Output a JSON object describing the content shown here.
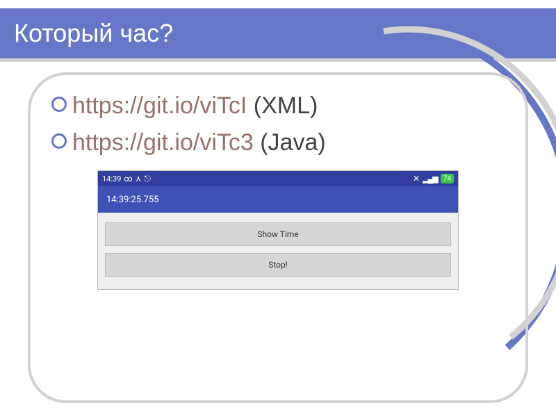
{
  "title": "Который час?",
  "bullets": [
    {
      "link": "https://git.io/viTcI",
      "suffix": " (XML)"
    },
    {
      "link": "https://git.io/viTc3",
      "suffix": " (Java)"
    }
  ],
  "phone": {
    "status": {
      "time": "14:39",
      "inf": "∞",
      "net": "⋏",
      "usb": "⎋",
      "mute": "✕",
      "signal": "▂▄▆",
      "batt": "74"
    },
    "appbar_time": "14:39:25.755",
    "buttons": {
      "show": "Show Time",
      "stop": "Stop!"
    }
  }
}
